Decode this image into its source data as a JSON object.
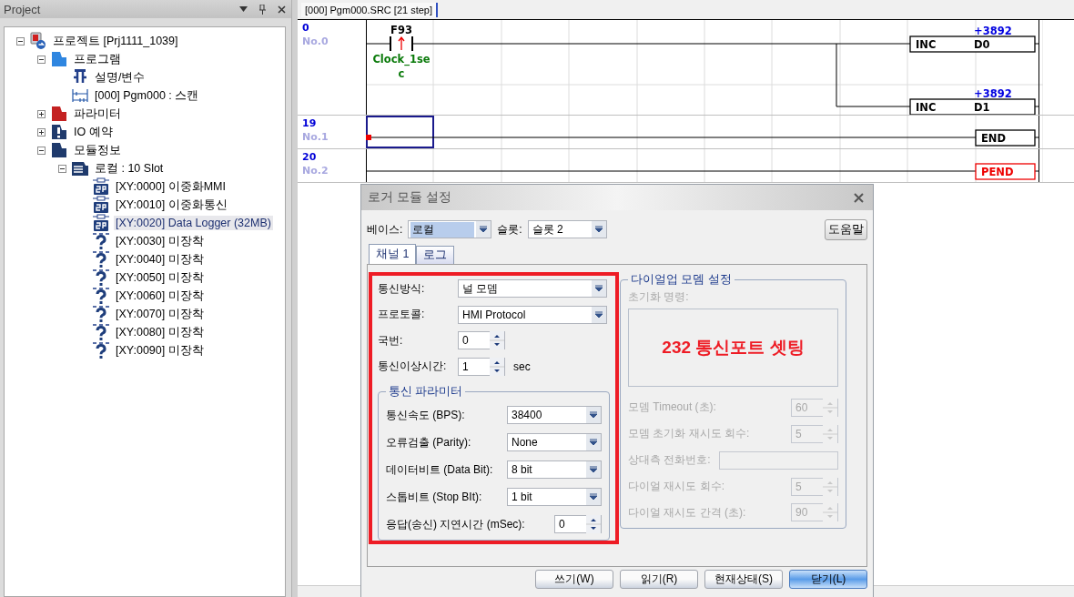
{
  "project_panel": {
    "title": "Project",
    "tree": [
      {
        "label": "프로젝트 [Prj1111_1039]",
        "kind": "project",
        "expanded": true,
        "selected": false,
        "children": [
          {
            "label": "프로그램",
            "kind": "program",
            "expanded": true,
            "selected": false,
            "children": [
              {
                "label": "설명/변수",
                "kind": "variable",
                "selected": false
              },
              {
                "label": "[000] Pgm000 : 스캔",
                "kind": "ladder",
                "selected": false
              }
            ]
          },
          {
            "label": "파라미터",
            "kind": "parameter",
            "expanded": false,
            "selected": false
          },
          {
            "label": "IO 예약",
            "kind": "io",
            "expanded": false,
            "selected": false
          },
          {
            "label": "모듈정보",
            "kind": "module_info",
            "expanded": true,
            "selected": false,
            "children": [
              {
                "label": "로컬 : 10 Slot",
                "kind": "base",
                "expanded": true,
                "selected": false,
                "children": [
                  {
                    "label": "[XY:0000] 이중화MMI",
                    "kind": "module",
                    "selected": false
                  },
                  {
                    "label": "[XY:0010] 이중화통신",
                    "kind": "module",
                    "selected": false
                  },
                  {
                    "label": "[XY:0020] Data Logger (32MB)",
                    "kind": "module",
                    "selected": true
                  },
                  {
                    "label": "[XY:0030] 미장착",
                    "kind": "empty",
                    "selected": false
                  },
                  {
                    "label": "[XY:0040] 미장착",
                    "kind": "empty",
                    "selected": false
                  },
                  {
                    "label": "[XY:0050] 미장착",
                    "kind": "empty",
                    "selected": false
                  },
                  {
                    "label": "[XY:0060] 미장착",
                    "kind": "empty",
                    "selected": false
                  },
                  {
                    "label": "[XY:0070] 미장착",
                    "kind": "empty",
                    "selected": false
                  },
                  {
                    "label": "[XY:0080] 미장착",
                    "kind": "empty",
                    "selected": false
                  },
                  {
                    "label": "[XY:0090] 미장착",
                    "kind": "empty",
                    "selected": false
                  }
                ]
              }
            ]
          }
        ]
      }
    ]
  },
  "editor": {
    "tab": "[000] Pgm000.SRC [21 step]",
    "rungs": [
      {
        "step": "0",
        "label": "No.0",
        "contact": {
          "device": "F93",
          "comment": [
            "Clock_1se",
            "c"
          ]
        },
        "outputs": [
          {
            "instruction": "INC",
            "operand": "D0",
            "value": "+3892",
            "error": false
          },
          {
            "instruction": "INC",
            "operand": "D1",
            "value": "+3892",
            "error": false
          }
        ]
      },
      {
        "step": "19",
        "label": "No.1",
        "cursor": true,
        "outputs": [
          {
            "instruction": "END",
            "error": false
          }
        ]
      },
      {
        "step": "20",
        "label": "No.2",
        "outputs": [
          {
            "instruction": "PEND",
            "error": true
          }
        ]
      }
    ]
  },
  "dialog": {
    "title": "로거 모듈 설정",
    "base": {
      "label": "베이스:",
      "value": "로컬",
      "focused": true
    },
    "slot": {
      "label": "슬롯:",
      "value": "슬롯 2",
      "focused": false
    },
    "help_button": "도움말",
    "tabs": [
      {
        "label": "채널 1",
        "selected": true
      },
      {
        "label": "로그",
        "selected": false
      }
    ],
    "channel_fields": [
      {
        "label": "통신방식:",
        "kind": "combo",
        "value": "널 모뎀"
      },
      {
        "label": "프로토콜:",
        "kind": "combo",
        "value": "HMI Protocol"
      },
      {
        "label": "국번:",
        "kind": "spin",
        "value": "0"
      },
      {
        "label": "통신이상시간:",
        "kind": "spin",
        "value": "1",
        "unit": "sec"
      }
    ],
    "comm_params": {
      "title": "통신 파라미터",
      "fields": [
        {
          "label": "통신속도 (BPS):",
          "kind": "combo",
          "value": "38400"
        },
        {
          "label": "오류검출 (Parity):",
          "kind": "combo",
          "value": "None"
        },
        {
          "label": "데이터비트 (Data Bit):",
          "kind": "combo",
          "value": "8 bit"
        },
        {
          "label": "스톱비트 (Stop BIt):",
          "kind": "combo",
          "value": "1 bit"
        },
        {
          "label": "응답(송신) 지연시간 (mSec):",
          "kind": "spin",
          "value": "0"
        }
      ]
    },
    "dialup": {
      "title": "다이얼업 모뎀 설정",
      "disabled": true,
      "init_label": "초기화 명령:",
      "annotation": "232 통신포트 셋팅",
      "fields": [
        {
          "label": "모뎀 Timeout (초):",
          "kind": "spin",
          "value": "60"
        },
        {
          "label": "모뎀 초기화 재시도 회수:",
          "kind": "spin",
          "value": "5"
        },
        {
          "label": "상대측 전화번호:",
          "kind": "text"
        },
        {
          "label": "다이얼 재시도 회수:",
          "kind": "spin",
          "value": "5"
        },
        {
          "label": "다이얼 재시도 간격 (초):",
          "kind": "spin",
          "value": "90"
        }
      ]
    },
    "buttons": [
      {
        "label": "쓰기(W)",
        "default": false
      },
      {
        "label": "읽기(R)",
        "default": false
      },
      {
        "label": "현재상태(S)",
        "default": false
      },
      {
        "label": "닫기(L)",
        "default": true
      }
    ]
  }
}
